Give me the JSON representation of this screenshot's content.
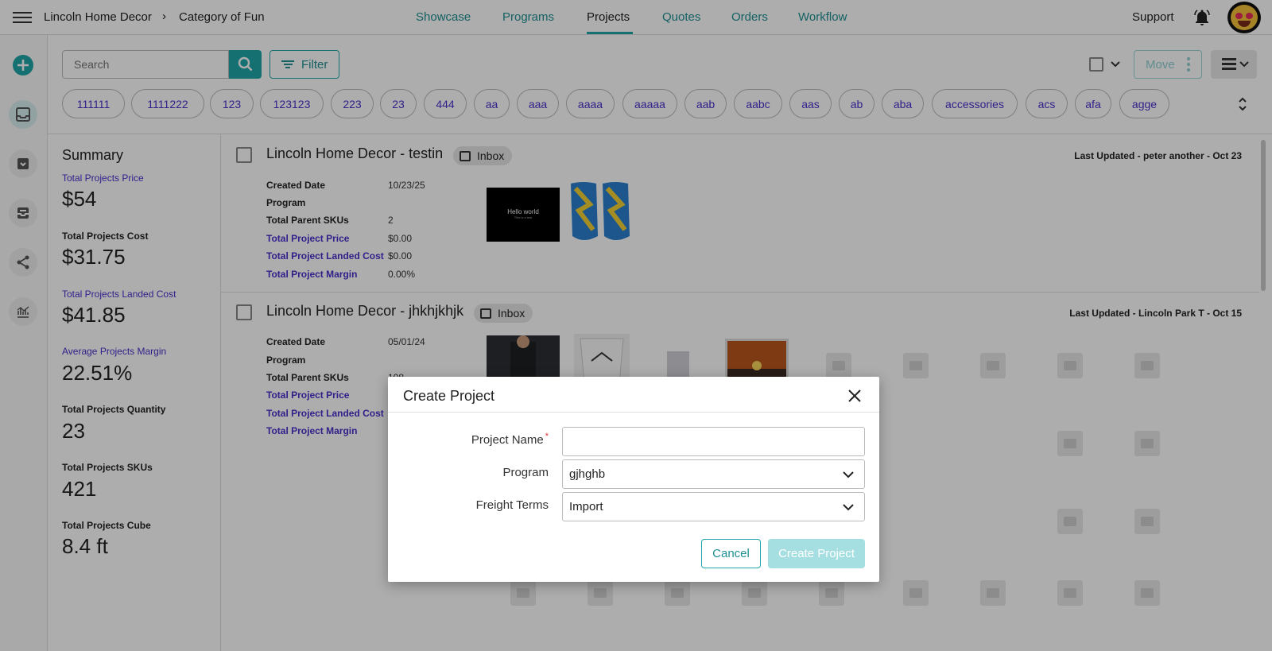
{
  "header": {
    "breadcrumb": [
      "Lincoln Home Decor",
      "Category of Fun"
    ],
    "breadcrumb_separator": "›",
    "nav": [
      "Showcase",
      "Programs",
      "Projects",
      "Quotes",
      "Orders",
      "Workflow"
    ],
    "active_nav": "Projects",
    "support": "Support"
  },
  "toolbar": {
    "search_placeholder": "Search",
    "filter_label": "Filter",
    "move_label": "Move"
  },
  "tags": [
    "111111",
    "1111222",
    "123",
    "123123",
    "223",
    "23",
    "444",
    "aa",
    "aaa",
    "aaaa",
    "aaaaa",
    "aab",
    "aabc",
    "aas",
    "ab",
    "aba",
    "accessories",
    "acs",
    "afa",
    "agge"
  ],
  "summary": {
    "title": "Summary",
    "items": [
      {
        "label": "Total Projects Price",
        "value": "$54"
      },
      {
        "label": "Total Projects Cost",
        "value": "$31.75"
      },
      {
        "label": "Total Projects Landed Cost",
        "value": "$41.85"
      },
      {
        "label": "Average Projects Margin",
        "value": "22.51%"
      },
      {
        "label": "Total Projects Quantity",
        "value": "23"
      },
      {
        "label": "Total Projects SKUs",
        "value": "421"
      },
      {
        "label": "Total Projects Cube",
        "value": "8.4 ft"
      }
    ]
  },
  "projects": [
    {
      "title": "Lincoln Home Decor - testin",
      "badge": "Inbox",
      "updated": "Last Updated - peter another - Oct 23",
      "fields": [
        {
          "label": "Created Date",
          "value": "10/23/25"
        },
        {
          "label": "Program",
          "value": ""
        },
        {
          "label": "Total Parent SKUs",
          "value": "2"
        },
        {
          "label": "Total Project Price",
          "value": "$0.00"
        },
        {
          "label": "Total Project Landed Cost",
          "value": "$0.00"
        },
        {
          "label": "Total Project Margin",
          "value": "0.00%"
        }
      ],
      "thumb_text": [
        "Hello world",
        "This is a test"
      ]
    },
    {
      "title": "Lincoln Home Decor - jhkhjkhjk",
      "badge": "Inbox",
      "updated": "Last Updated - Lincoln Park T - Oct 15",
      "fields": [
        {
          "label": "Created Date",
          "value": "05/01/24"
        },
        {
          "label": "Program",
          "value": ""
        },
        {
          "label": "Total Parent SKUs",
          "value": "108"
        },
        {
          "label": "Total Project Price",
          "value": ""
        },
        {
          "label": "Total Project Landed Cost",
          "value": ""
        },
        {
          "label": "Total Project Margin",
          "value": ""
        }
      ]
    }
  ],
  "modal": {
    "title": "Create Project",
    "project_name_label": "Project Name",
    "required_mark": "*",
    "project_name_value": "",
    "program_label": "Program",
    "program_value": "gjhghb",
    "freight_label": "Freight Terms",
    "freight_value": "Import",
    "cancel_label": "Cancel",
    "create_label": "Create Project"
  },
  "colors": {
    "accent": "#1fa5a9",
    "link_purple": "#4b2fcc"
  }
}
